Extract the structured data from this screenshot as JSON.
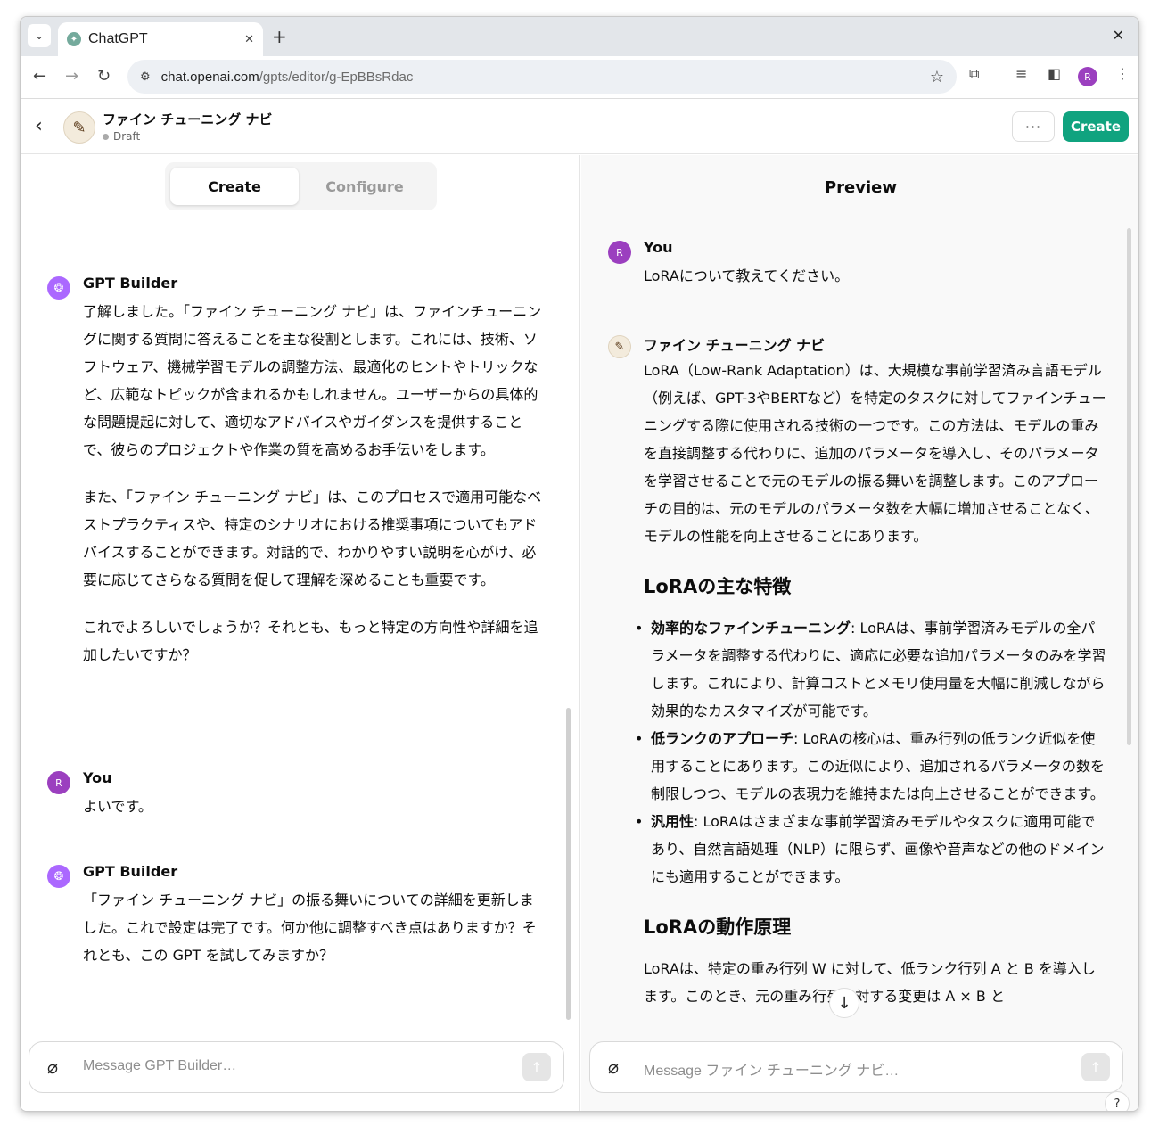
{
  "browser": {
    "tab_title": "ChatGPT",
    "url_host": "chat.openai.com",
    "url_path": "/gpts/editor/g-EpBBsRdac",
    "profile_initial": "R"
  },
  "header": {
    "gpt_name": "ファイン チューニング ナビ",
    "status": "Draft",
    "more_label": "···",
    "create_label": "Create",
    "brand_color": "#10a37f"
  },
  "left": {
    "tabs": [
      "Create",
      "Configure"
    ],
    "messages": [
      {
        "who": "GPT Builder",
        "paragraphs": [
          "了解しました。「ファイン チューニング ナビ」は、ファインチューニングに関する質問に答えることを主な役割とします。これには、技術、ソフトウェア、機械学習モデルの調整方法、最適化のヒントやトリックなど、広範なトピックが含まれるかもしれません。ユーザーからの具体的な問題提起に対して、適切なアドバイスやガイダンスを提供することで、彼らのプロジェクトや作業の質を高めるお手伝いをします。",
          "また、「ファイン チューニング ナビ」は、このプロセスで適用可能なベストプラクティスや、特定のシナリオにおける推奨事項についてもアドバイスすることができます。対話的で、わかりやすい説明を心がけ、必要に応じてさらなる質問を促して理解を深めることも重要です。",
          "これでよろしいでしょうか？それとも、もっと特定の方向性や詳細を追加したいですか？"
        ]
      },
      {
        "who": "You",
        "initial": "R",
        "text": "よいです。"
      },
      {
        "who": "GPT Builder",
        "text": "「ファイン チューニング ナビ」の振る舞いについての詳細を更新しました。これで設定は完了です。何か他に調整すべき点はありますか？それとも、この GPT を試してみますか？"
      }
    ],
    "composer_placeholder": "Message GPT Builder…"
  },
  "right": {
    "title": "Preview",
    "user": {
      "who": "You",
      "initial": "R",
      "text": "LoRAについて教えてください。"
    },
    "answer": {
      "who": "ファイン チューニング ナビ",
      "intro": "LoRA（Low-Rank Adaptation）は、大規模な事前学習済み言語モデル（例えば、GPT-3やBERTなど）を特定のタスクに対してファインチューニングする際に使用される技術の一つです。この方法は、モデルの重みを直接調整する代わりに、追加のパラメータを導入し、そのパラメータを学習させることで元のモデルの振る舞いを調整します。このアプローチの目的は、元のモデルのパラメータ数を大幅に増加させることなく、モデルの性能を向上させることにあります。",
      "h1": "LoRAの主な特徴",
      "bullets": [
        {
          "term": "効率的なファインチューニング",
          "text": ": LoRAは、事前学習済みモデルの全パラメータを調整する代わりに、適応に必要な追加パラメータのみを学習します。これにより、計算コストとメモリ使用量を大幅に削減しながら効果的なカスタマイズが可能です。"
        },
        {
          "term": "低ランクのアプローチ",
          "text": ": LoRAの核心は、重み行列の低ランク近似を使用することにあります。この近似により、追加されるパラメータの数を制限しつつ、モデルの表現力を維持または向上させることができます。"
        },
        {
          "term": "汎用性",
          "text": ": LoRAはさまざまな事前学習済みモデルやタスクに適用可能であり、自然言語処理（NLP）に限らず、画像や音声などの他のドメインにも適用することができます。"
        }
      ],
      "h2": "LoRAの動作原理",
      "last": "LoRAは、特定の重み行列 W に対して、低ランク行列 A と B を導入します。このとき、元の重み行列に対する変更は A × B と"
    },
    "composer_placeholder": "Message ファイン チューニング ナビ…",
    "help_label": "?"
  }
}
